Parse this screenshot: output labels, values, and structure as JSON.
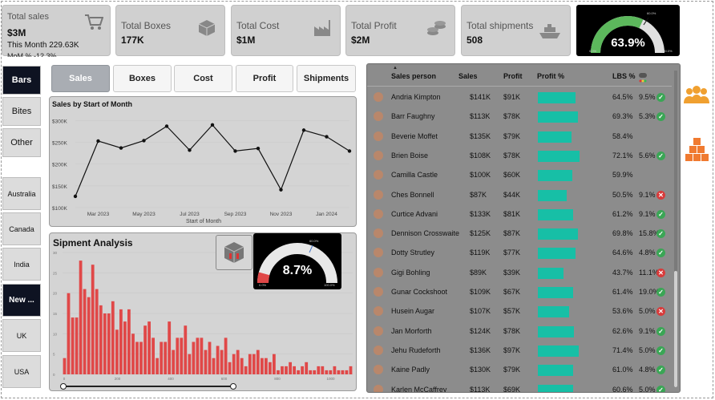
{
  "kpis": {
    "sales": {
      "title": "Total sales",
      "value": "$3M",
      "sub": "This Month 229.63K",
      "sub2": "MoM % -12.3%",
      "badge": "-12.3%"
    },
    "boxes": {
      "title": "Total Boxes",
      "value": "177K"
    },
    "cost": {
      "title": "Total Cost",
      "value": "$1M"
    },
    "profit": {
      "title": "Total Profit",
      "value": "$2M"
    },
    "shipments": {
      "title": "Total shipments",
      "value": "508"
    }
  },
  "gauge_main": {
    "value": "63.9%",
    "fraction": 0.639,
    "min": "0.0%",
    "max": "100.0%",
    "target": "60.0%"
  },
  "tabs": [
    "Sales",
    "Boxes",
    "Cost",
    "Profit",
    "Shipments"
  ],
  "category_buttons": [
    "Bars",
    "Bites",
    "Other"
  ],
  "country_buttons": [
    "Australia",
    "Canada",
    "India",
    "New ...",
    "UK",
    "USA"
  ],
  "line_chart": {
    "title": "Sales by Start of Month",
    "xlabel": "Start of Month"
  },
  "shipment": {
    "title": "Sipment Analysis",
    "gauge_value": "8.7%",
    "fraction": 0.087,
    "min": "0.0%",
    "max": "100.0%",
    "target": "60.0%"
  },
  "chart_data": [
    {
      "type": "line",
      "title": "Sales by Start of Month",
      "xlabel": "Start of Month",
      "ylabel": "",
      "x": [
        "Feb 2023",
        "Mar 2023",
        "Apr 2023",
        "May 2023",
        "Jun 2023",
        "Jul 2023",
        "Aug 2023",
        "Sep 2023",
        "Oct 2023",
        "Nov 2023",
        "Dec 2023",
        "Jan 2024",
        "Feb 2024"
      ],
      "x_tick_labels": [
        "Mar 2023",
        "May 2023",
        "Jul 2023",
        "Sep 2023",
        "Nov 2023",
        "Jan 2024"
      ],
      "values": [
        126000,
        253000,
        237000,
        254000,
        287000,
        232000,
        290000,
        230000,
        236000,
        141000,
        278000,
        263000,
        230000
      ],
      "y_tick_labels": [
        "$100K",
        "$150K",
        "$200K",
        "$250K",
        "$300K"
      ],
      "ylim": [
        100000,
        310000
      ]
    },
    {
      "type": "bar",
      "title": "Sipment Analysis",
      "x_tick_labels": [
        "0",
        "200",
        "400",
        "600",
        "800",
        "1000"
      ],
      "y_tick_labels": [
        "0",
        "5",
        "10",
        "15",
        "20",
        "25",
        "30"
      ],
      "ylim": [
        0,
        30
      ],
      "values": [
        4,
        20,
        14,
        14,
        28,
        21,
        19,
        27,
        21,
        17,
        15,
        15,
        18,
        11,
        16,
        13,
        16,
        10,
        8,
        8,
        12,
        13,
        9,
        4,
        8,
        8,
        13,
        6,
        9,
        9,
        12,
        5,
        8,
        9,
        9,
        6,
        8,
        4,
        7,
        6,
        9,
        3,
        5,
        6,
        4,
        2,
        5,
        5,
        6,
        4,
        4,
        3,
        5,
        1,
        2,
        2,
        3,
        2,
        1,
        2,
        3,
        1,
        1,
        2,
        2,
        1,
        1,
        2,
        1,
        1,
        1,
        2
      ]
    }
  ],
  "table": {
    "headers": {
      "person": "Sales person",
      "sales": "Sales",
      "profit": "Profit",
      "profit_pct": "Profit %",
      "lbs": "LBS %"
    },
    "rows": [
      {
        "name": "Andria Kimpton",
        "sales": "$141K",
        "profit": "$91K",
        "pct": "64.5%",
        "pct_val": 64.5,
        "lbs": "9.5%",
        "status": "ok"
      },
      {
        "name": "Barr Faughny",
        "sales": "$113K",
        "profit": "$78K",
        "pct": "69.3%",
        "pct_val": 69.3,
        "lbs": "5.3%",
        "status": "ok"
      },
      {
        "name": "Beverie Moffet",
        "sales": "$135K",
        "profit": "$79K",
        "pct": "58.4%",
        "pct_val": 58.4,
        "lbs": "",
        "status": ""
      },
      {
        "name": "Brien Boise",
        "sales": "$108K",
        "profit": "$78K",
        "pct": "72.1%",
        "pct_val": 72.1,
        "lbs": "5.6%",
        "status": "ok"
      },
      {
        "name": "Camilla Castle",
        "sales": "$100K",
        "profit": "$60K",
        "pct": "59.9%",
        "pct_val": 59.9,
        "lbs": "",
        "status": ""
      },
      {
        "name": "Ches Bonnell",
        "sales": "$87K",
        "profit": "$44K",
        "pct": "50.5%",
        "pct_val": 50.5,
        "lbs": "9.1%",
        "status": "bad"
      },
      {
        "name": "Curtice Advani",
        "sales": "$133K",
        "profit": "$81K",
        "pct": "61.2%",
        "pct_val": 61.2,
        "lbs": "9.1%",
        "status": "ok"
      },
      {
        "name": "Dennison Crosswaite",
        "sales": "$125K",
        "profit": "$87K",
        "pct": "69.8%",
        "pct_val": 69.8,
        "lbs": "15.8%",
        "status": "ok"
      },
      {
        "name": "Dotty Strutley",
        "sales": "$119K",
        "profit": "$77K",
        "pct": "64.6%",
        "pct_val": 64.6,
        "lbs": "4.8%",
        "status": "ok"
      },
      {
        "name": "Gigi Bohling",
        "sales": "$89K",
        "profit": "$39K",
        "pct": "43.7%",
        "pct_val": 43.7,
        "lbs": "11.1%",
        "status": "bad"
      },
      {
        "name": "Gunar Cockshoot",
        "sales": "$109K",
        "profit": "$67K",
        "pct": "61.4%",
        "pct_val": 61.4,
        "lbs": "19.0%",
        "status": "ok"
      },
      {
        "name": "Husein Augar",
        "sales": "$107K",
        "profit": "$57K",
        "pct": "53.6%",
        "pct_val": 53.6,
        "lbs": "5.0%",
        "status": "bad"
      },
      {
        "name": "Jan Morforth",
        "sales": "$124K",
        "profit": "$78K",
        "pct": "62.6%",
        "pct_val": 62.6,
        "lbs": "9.1%",
        "status": "ok"
      },
      {
        "name": "Jehu Rudeforth",
        "sales": "$136K",
        "profit": "$97K",
        "pct": "71.4%",
        "pct_val": 71.4,
        "lbs": "5.0%",
        "status": "ok"
      },
      {
        "name": "Kaine Padly",
        "sales": "$130K",
        "profit": "$79K",
        "pct": "61.0%",
        "pct_val": 61.0,
        "lbs": "4.8%",
        "status": "ok"
      },
      {
        "name": "Karlen McCaffrey",
        "sales": "$113K",
        "profit": "$69K",
        "pct": "60.6%",
        "pct_val": 60.6,
        "lbs": "5.0%",
        "status": "ok"
      }
    ]
  },
  "icons": [
    "cart-icon",
    "box-icon",
    "factory-icon",
    "coins-icon",
    "ship-icon",
    "people-icon",
    "boxes-stack-icon"
  ],
  "colors": {
    "accent": "#17bfa6",
    "bar": "#e04848",
    "gauge": "#5cb85c",
    "dark": "#0e1322"
  }
}
